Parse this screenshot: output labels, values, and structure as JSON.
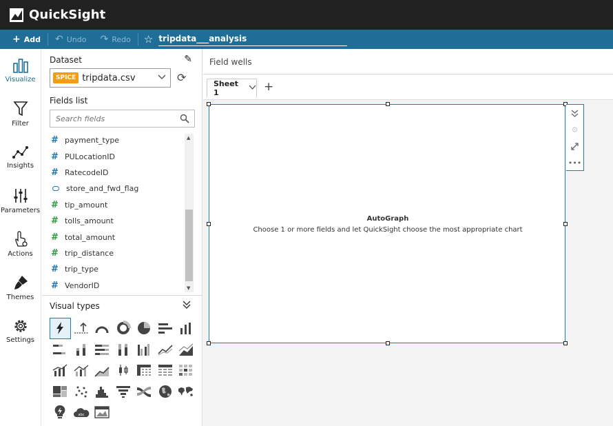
{
  "app": {
    "name": "QuickSight"
  },
  "toolbar": {
    "add_label": "Add",
    "undo_label": "Undo",
    "redo_label": "Redo",
    "analysis_title": "tripdata___analysis"
  },
  "rail": {
    "items": [
      {
        "label": "Visualize",
        "icon": "bar-chart-icon"
      },
      {
        "label": "Filter",
        "icon": "funnel-icon"
      },
      {
        "label": "Insights",
        "icon": "line-dots-icon"
      },
      {
        "label": "Parameters",
        "icon": "sliders-icon"
      },
      {
        "label": "Actions",
        "icon": "hand-gear-icon"
      },
      {
        "label": "Themes",
        "icon": "brush-icon"
      },
      {
        "label": "Settings",
        "icon": "gear-icon"
      }
    ]
  },
  "panel": {
    "dataset_label": "Dataset",
    "dataset_badge": "SPICE",
    "dataset_name": "tripdata.csv",
    "fields_label": "Fields list",
    "search_placeholder": "Search fields",
    "fields": [
      {
        "name": "payment_type",
        "kind": "dimension-number"
      },
      {
        "name": "PULocationID",
        "kind": "dimension-number"
      },
      {
        "name": "RatecodeID",
        "kind": "dimension-number"
      },
      {
        "name": "store_and_fwd_flag",
        "kind": "dimension-string"
      },
      {
        "name": "tip_amount",
        "kind": "measure"
      },
      {
        "name": "tolls_amount",
        "kind": "measure"
      },
      {
        "name": "total_amount",
        "kind": "measure"
      },
      {
        "name": "trip_distance",
        "kind": "measure"
      },
      {
        "name": "trip_type",
        "kind": "dimension-number"
      },
      {
        "name": "VendorID",
        "kind": "dimension-number"
      }
    ],
    "visual_types_label": "Visual types"
  },
  "main": {
    "field_wells_label": "Field wells",
    "sheet_tab_label": "Sheet 1",
    "visual_title": "AutoGraph",
    "visual_subtitle": "Choose 1 or more fields and let QuickSight choose the most appropriate chart"
  },
  "colors": {
    "header_bg": "#212121",
    "toolbar_bg": "#1e6e97",
    "accent": "#1e7bb5",
    "spice": "#f39c16",
    "measure": "#2f9a41"
  }
}
